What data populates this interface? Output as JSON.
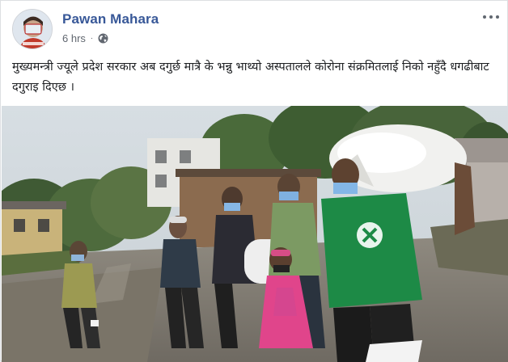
{
  "post": {
    "author": "Pawan Mahara",
    "time": "6 hrs",
    "separator": "·",
    "privacy_icon": "globe-icon",
    "more_icon": "more-options-icon",
    "text": "मुख्यमन्त्री ज्यूले प्रदेश सरकार अब दगुर्छ मात्रै के भन्नु भाथ्यो अस्पतालले कोरोना संक्रमितलाई निको नहुँदै धगढीबाट दगुराइ दिएछ ।"
  },
  "colors": {
    "author": "#385898",
    "meta": "#616770",
    "text": "#1c1e21"
  }
}
